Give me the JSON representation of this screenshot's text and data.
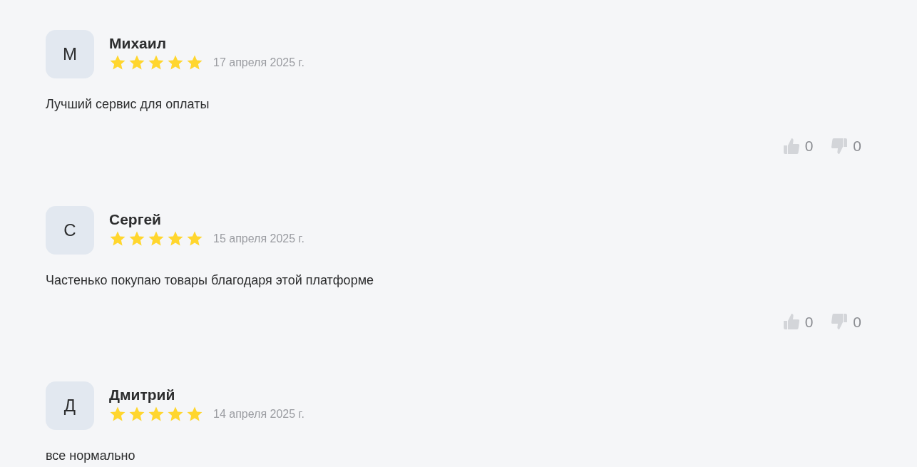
{
  "reviews": [
    {
      "initial": "М",
      "name": "Михаил",
      "stars": 5,
      "date": "17 апреля 2025 г.",
      "text": "Лучший сервис для оплаты",
      "likes": "0",
      "dislikes": "0"
    },
    {
      "initial": "С",
      "name": "Сергей",
      "stars": 5,
      "date": "15 апреля 2025 г.",
      "text": "Частенько покупаю товары благодаря этой платформе",
      "likes": "0",
      "dislikes": "0"
    },
    {
      "initial": "Д",
      "name": "Дмитрий",
      "stars": 5,
      "date": "14 апреля 2025 г.",
      "text": "все нормально"
    }
  ]
}
